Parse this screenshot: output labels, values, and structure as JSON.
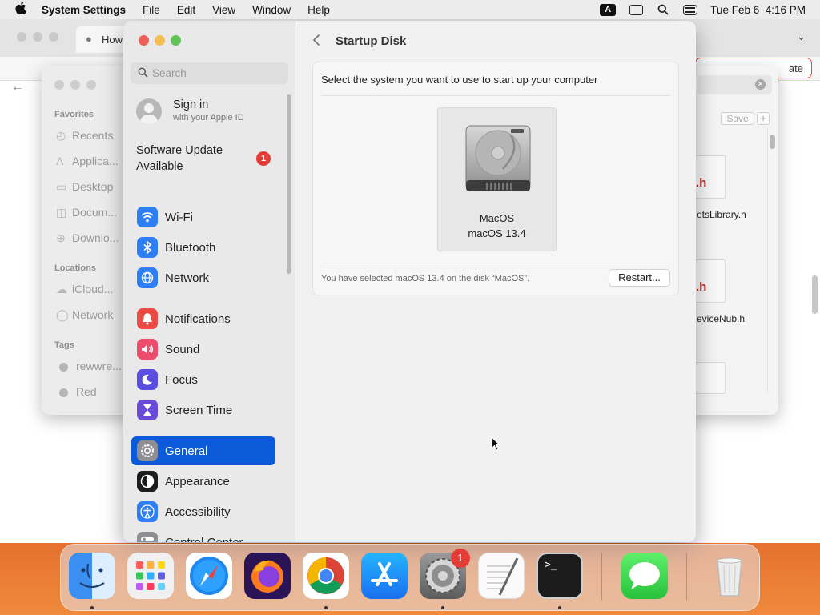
{
  "menubar": {
    "app_name": "System Settings",
    "menus": [
      "File",
      "Edit",
      "View",
      "Window",
      "Help"
    ],
    "input_indicator": "A",
    "datetime": "Tue Feb 6  4:16 PM"
  },
  "browser": {
    "tab_title": "How",
    "toolbar_button_fragment": "ate"
  },
  "finder": {
    "favorites_heading": "Favorites",
    "favorites": [
      "Recents",
      "Applica...",
      "Desktop",
      "Docum...",
      "Downlo..."
    ],
    "locations_heading": "Locations",
    "locations": [
      "iCloud...",
      "Network"
    ],
    "tags_heading": "Tags",
    "tags": [
      "rewwre...",
      "Red"
    ],
    "save_label": "Save",
    "plus_label": "+",
    "files": [
      {
        "ext": ".h",
        "name": "etsLibrary.h"
      },
      {
        "ext": ".h",
        "name": "eviceNub.h"
      }
    ]
  },
  "settings": {
    "search_placeholder": "Search",
    "signin_title": "Sign in",
    "signin_subtitle": "with your Apple ID",
    "update_label": "Software Update Available",
    "update_badge": "1",
    "nav": [
      {
        "label": "Wi-Fi",
        "icon": "wifi-icon",
        "color": "#2f7ef6"
      },
      {
        "label": "Bluetooth",
        "icon": "bluetooth-icon",
        "color": "#2f7ef6"
      },
      {
        "label": "Network",
        "icon": "globe-icon",
        "color": "#2f7ef6"
      },
      {
        "label": "Notifications",
        "icon": "bell-icon",
        "color": "#ec4b45"
      },
      {
        "label": "Sound",
        "icon": "speaker-icon",
        "color": "#ec4b6a"
      },
      {
        "label": "Focus",
        "icon": "moon-icon",
        "color": "#5a4ee0"
      },
      {
        "label": "Screen Time",
        "icon": "hourglass-icon",
        "color": "#6a4ad8"
      },
      {
        "label": "General",
        "icon": "gear-icon",
        "color": "#8e8e93",
        "selected": true
      },
      {
        "label": "Appearance",
        "icon": "appearance-icon",
        "color": "#1c1c1e"
      },
      {
        "label": "Accessibility",
        "icon": "accessibility-icon",
        "color": "#2f7ef6"
      },
      {
        "label": "Control Center",
        "icon": "control-center-icon",
        "color": "#8e8e93"
      }
    ],
    "page_title": "Startup Disk",
    "prompt": "Select the system you want to use to start up your computer",
    "disk_name": "MacOS",
    "disk_os": "macOS 13.4",
    "status": "You have selected macOS 13.4 on the disk “MacOS”.",
    "restart_label": "Restart..."
  },
  "dock": {
    "apps": [
      "Finder",
      "Launchpad",
      "Safari",
      "Firefox",
      "Chrome",
      "App Store",
      "System Settings",
      "TextEdit",
      "Terminal",
      "Messages",
      "Trash"
    ],
    "settings_badge": "1",
    "terminal_prompt": ">_"
  },
  "colors": {
    "accent": "#0b5ad9",
    "badge_red": "#e43c36",
    "close_red": "#ee5f57",
    "minimize_yellow": "#f4bd4f",
    "zoom_green": "#5fc454"
  }
}
